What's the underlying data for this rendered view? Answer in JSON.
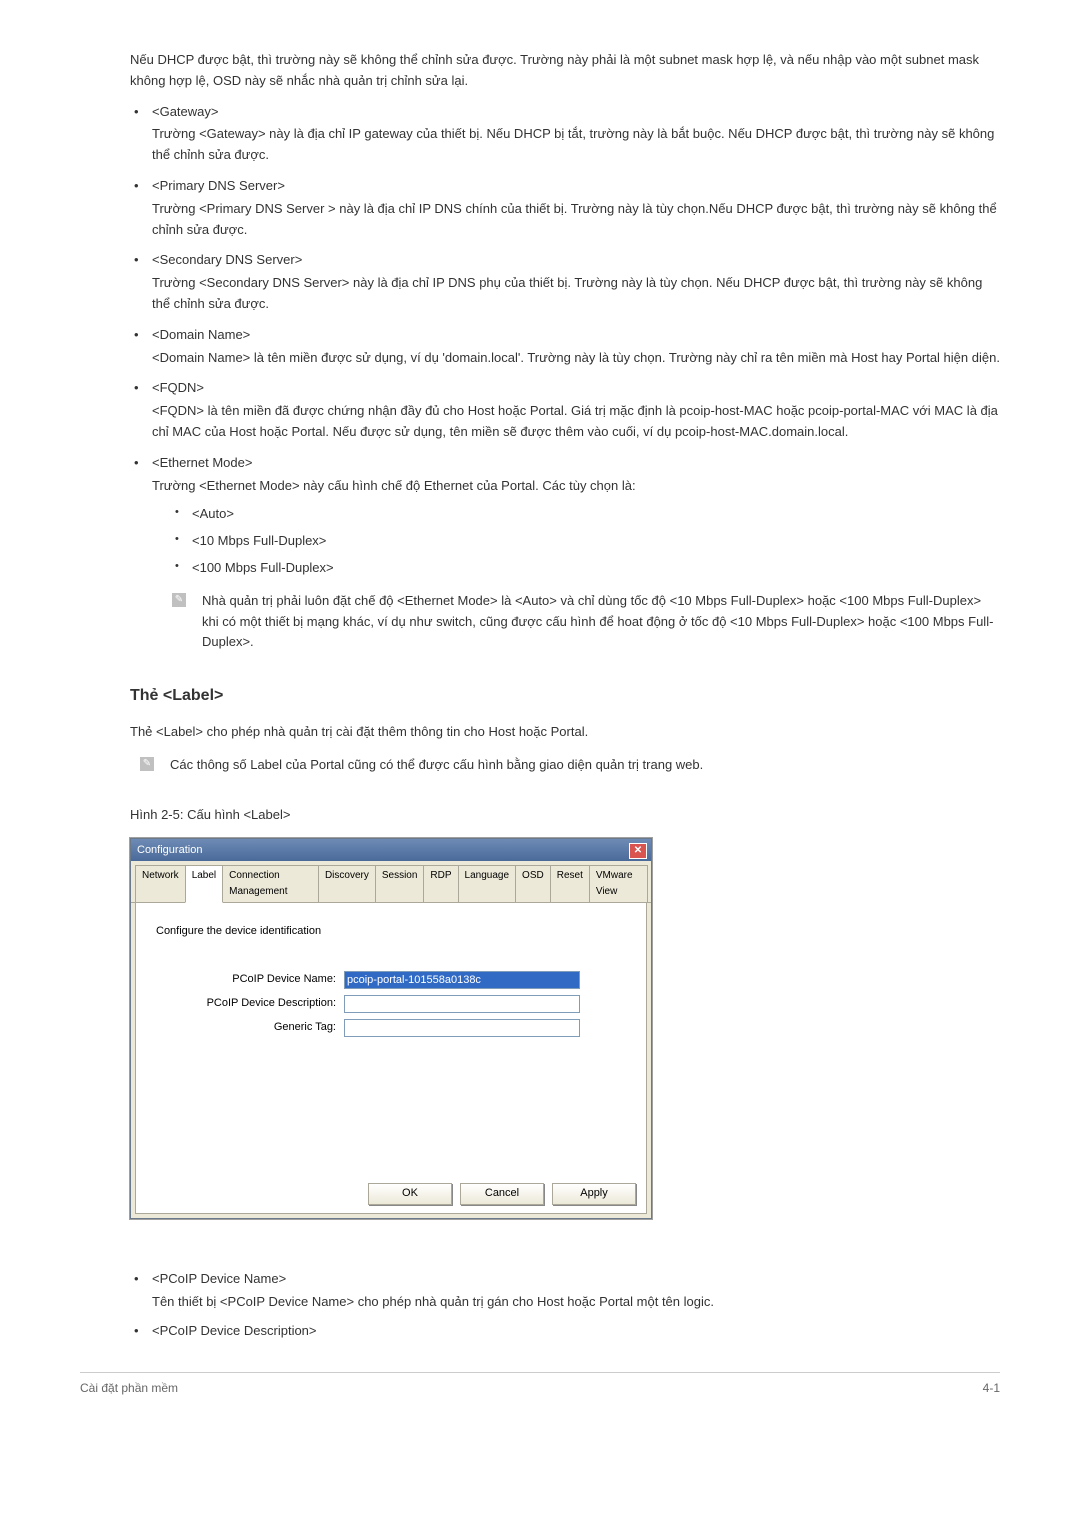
{
  "intro": "Nếu DHCP được bật, thì trường này sẽ không thể chỉnh sửa được. Trường này phải là một subnet mask hợp lệ, và nếu nhập vào một subnet mask không hợp lệ, OSD này sẽ nhắc nhà quản trị chỉnh sửa lại.",
  "items": [
    {
      "title": "<Gateway>",
      "desc": "Trường <Gateway> này là địa chỉ IP gateway của thiết bị. Nếu DHCP bị tắt, trường này là bắt buộc. Nếu DHCP được bật, thì trường này sẽ không thể chỉnh sửa được."
    },
    {
      "title": "<Primary DNS Server>",
      "desc": "Trường <Primary DNS Server > này là địa chỉ IP DNS chính của thiết bị. Trường này là tùy chọn.Nếu DHCP được bật, thì trường này sẽ không thể chỉnh sửa được."
    },
    {
      "title": "<Secondary DNS Server>",
      "desc": "Trường <Secondary DNS Server> này là địa chỉ IP DNS phụ của thiết bị. Trường này là tùy chọn. Nếu DHCP được bật, thì trường này sẽ không thể chỉnh sửa được."
    },
    {
      "title": "<Domain Name>",
      "desc": "<Domain Name> là tên miền được sử dụng, ví dụ 'domain.local'. Trường này là tùy chọn. Trường này chỉ ra tên miền mà Host hay Portal hiện diện."
    },
    {
      "title": "<FQDN>",
      "desc": "<FQDN> là tên miền đã được chứng nhận đầy đủ cho Host hoặc Portal. Giá trị mặc định là pcoip-host-MAC hoặc pcoip-portal-MAC với MAC là địa chỉ MAC của Host hoặc Portal. Nếu được sử dụng, tên miền sẽ được thêm vào cuối, ví dụ pcoip-host-MAC.domain.local."
    }
  ],
  "ethernet": {
    "title": "<Ethernet Mode>",
    "desc": "Trường <Ethernet Mode> này cấu hình chế độ Ethernet của Portal. Các tùy chọn là:",
    "options": [
      "<Auto>",
      "<10 Mbps Full-Duplex>",
      "<100 Mbps Full-Duplex>"
    ],
    "note": "Nhà quản trị phải luôn đặt chế độ <Ethernet Mode> là <Auto> và chỉ dùng tốc độ <10 Mbps Full-Duplex> hoặc <100 Mbps Full-Duplex> khi có một thiết bị mạng khác, ví dụ như switch, cũng được cấu hình để hoat động ở tốc độ <10 Mbps Full-Duplex> hoặc <100 Mbps Full-Duplex>."
  },
  "label_section": {
    "heading": "Thẻ <Label>",
    "intro": "Thẻ <Label> cho phép nhà quản trị cài đặt thêm thông tin cho Host hoặc Portal.",
    "note": "Các thông số Label của Portal cũng có thể được cấu hình bằng giao diện quản trị trang web.",
    "figure_caption": "Hình 2-5: Cấu hình <Label>"
  },
  "dialog": {
    "title": "Configuration",
    "tabs": [
      "Network",
      "Label",
      "Connection Management",
      "Discovery",
      "Session",
      "RDP",
      "Language",
      "OSD",
      "Reset",
      "VMware View"
    ],
    "active_tab": "Label",
    "panel_heading": "Configure the device identification",
    "fields": [
      {
        "label": "PCoIP Device Name:",
        "value": "pcoip-portal-101558a0138c",
        "selected": true
      },
      {
        "label": "PCoIP Device Description:",
        "value": "",
        "selected": false
      },
      {
        "label": "Generic Tag:",
        "value": "",
        "selected": false
      }
    ],
    "buttons": {
      "ok": "OK",
      "cancel": "Cancel",
      "apply": "Apply"
    }
  },
  "bottom_items": [
    {
      "title": "<PCoIP Device Name>",
      "desc": "Tên thiết bị <PCoIP Device Name> cho phép nhà quản trị gán cho Host hoặc Portal một tên logic."
    },
    {
      "title": "<PCoIP Device Description>",
      "desc": ""
    }
  ],
  "footer": {
    "left": "Cài đặt phần mềm",
    "right": "4-1"
  },
  "note_glyph": "✎"
}
